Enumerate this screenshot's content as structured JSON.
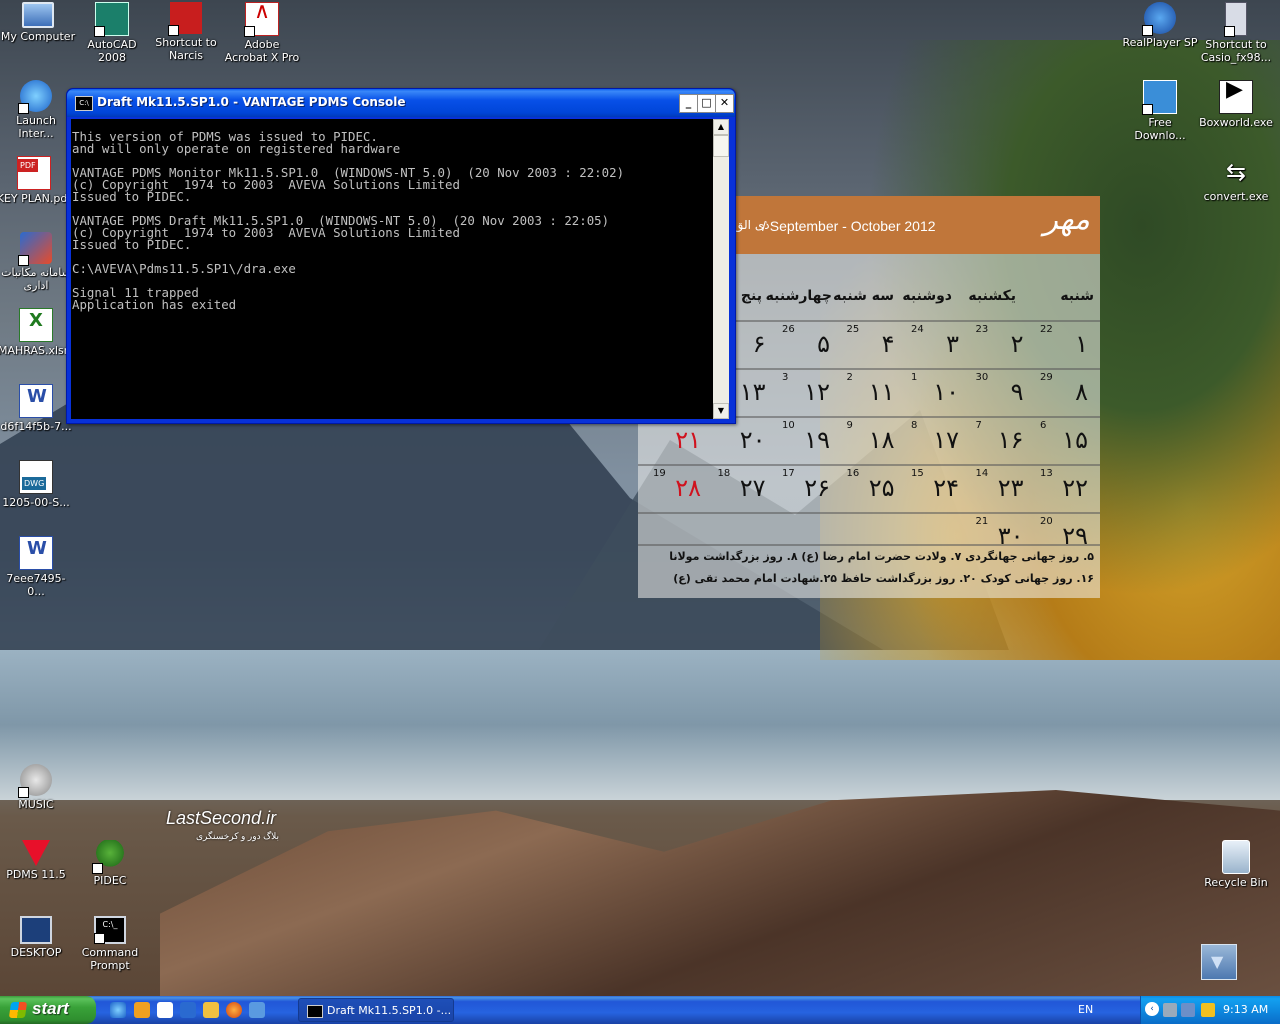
{
  "desktop": {
    "icons_left": [
      {
        "label": "My Computer",
        "icon": "my-computer-icon"
      },
      {
        "label": "AutoCAD 2008",
        "icon": "autocad-icon"
      },
      {
        "label": "Shortcut to Narcis",
        "icon": "narcis-icon"
      },
      {
        "label": "Adobe Acrobat X Pro",
        "icon": "acrobat-icon"
      },
      {
        "label": "Launch Inter...",
        "icon": "internet-explorer-icon"
      },
      {
        "label": "KEY PLAN.pdf",
        "icon": "pdf-file-icon"
      },
      {
        "label": "سامانه مكاتبات اداری",
        "icon": "correspondence-app-icon"
      },
      {
        "label": "MAHRAS.xlsm",
        "icon": "excel-file-icon"
      },
      {
        "label": "d6f14f5b-7...",
        "icon": "word-file-icon"
      },
      {
        "label": "1205-00-S...",
        "icon": "dwg-file-icon"
      },
      {
        "label": "7eee7495-0...",
        "icon": "word-file-icon"
      },
      {
        "label": "MUSIC",
        "icon": "music-folder-icon"
      },
      {
        "label": "PDMS 11.5",
        "icon": "pdms-icon"
      },
      {
        "label": "PIDEC",
        "icon": "pidec-icon"
      },
      {
        "label": "DESKTOP",
        "icon": "desktop-folder-icon"
      },
      {
        "label": "Command Prompt",
        "icon": "command-prompt-icon"
      }
    ],
    "icons_right": [
      {
        "label": "RealPlayer SP",
        "icon": "realplayer-icon"
      },
      {
        "label": "Shortcut to Casio_fx98...",
        "icon": "casio-icon"
      },
      {
        "label": "Free Downlo...",
        "icon": "free-download-icon"
      },
      {
        "label": "Boxworld.exe",
        "icon": "boxworld-icon"
      },
      {
        "label": "convert.exe",
        "icon": "convert-icon"
      },
      {
        "label": "Recycle Bin",
        "icon": "recycle-bin-icon"
      }
    ],
    "watermark": {
      "title": "LastSecond.ir",
      "subtitle": "بلاگ دور و كرخسنگری"
    }
  },
  "calendar": {
    "title_prefix": "ذی الق",
    "title": "/ September - October  2012",
    "month_name": "مهر",
    "weekdays": [
      "شنبه",
      "یکشنبه",
      "دوشنبه",
      "سه شنبه",
      "چهارشنبه",
      "پنج ش"
    ],
    "rows": [
      [
        {
          "n": "۱",
          "s": "22"
        },
        {
          "n": "۲",
          "s": "23"
        },
        {
          "n": "۳",
          "s": "24"
        },
        {
          "n": "۴",
          "s": "25"
        },
        {
          "n": "۵",
          "s": "26"
        },
        {
          "n": "۶",
          "s": ""
        }
      ],
      [
        {
          "n": "۸",
          "s": "29"
        },
        {
          "n": "۹",
          "s": "30"
        },
        {
          "n": "۱۰",
          "s": "1"
        },
        {
          "n": "۱۱",
          "s": "2"
        },
        {
          "n": "۱۲",
          "s": "3"
        },
        {
          "n": "۱۳",
          "s": ""
        }
      ],
      [
        {
          "n": "۱۵",
          "s": "6"
        },
        {
          "n": "۱۶",
          "s": "7"
        },
        {
          "n": "۱۷",
          "s": "8"
        },
        {
          "n": "۱۸",
          "s": "9"
        },
        {
          "n": "۱۹",
          "s": "10"
        },
        {
          "n": "۲۰",
          "s": ""
        },
        {
          "n": "۲۱",
          "s": "",
          "holiday": true
        }
      ],
      [
        {
          "n": "۲۲",
          "s": "13"
        },
        {
          "n": "۲۳",
          "s": "14"
        },
        {
          "n": "۲۴",
          "s": "15"
        },
        {
          "n": "۲۵",
          "s": "16"
        },
        {
          "n": "۲۶",
          "s": "17"
        },
        {
          "n": "۲۷",
          "s": "18"
        },
        {
          "n": "۲۸",
          "s": "19",
          "holiday": true
        }
      ],
      [
        {
          "n": "۲۹",
          "s": "20"
        },
        {
          "n": "۳۰",
          "s": "21"
        }
      ]
    ],
    "events": [
      "۵. روز جهانی جهانگردی   ۷. ولادت حضرت امام رضا (ع)   ۸. روز بزرگداشت مولانا",
      "۱۶. روز جهانی کودک   ۲۰. روز بزرگداشت حافظ   ۲۵.شهادت امام محمد تقی (ع)"
    ]
  },
  "window": {
    "title": "Draft Mk11.5.SP1.0 - VANTAGE PDMS Console",
    "console_lines": [
      "",
      "This version of PDMS was issued to PIDEC.",
      "and will only operate on registered hardware",
      "",
      "VANTAGE PDMS Monitor Mk11.5.SP1.0  (WINDOWS-NT 5.0)  (20 Nov 2003 : 22:02)",
      "(c) Copyright  1974 to 2003  AVEVA Solutions Limited",
      "Issued to PIDEC.",
      "",
      "VANTAGE PDMS Draft Mk11.5.SP1.0  (WINDOWS-NT 5.0)  (20 Nov 2003 : 22:05)",
      "(c) Copyright  1974 to 2003  AVEVA Solutions Limited",
      "Issued to PIDEC.",
      "",
      "C:\\AVEVA\\Pdms11.5.SP1\\/dra.exe",
      "",
      "Signal 11 trapped",
      "Application has exited"
    ]
  },
  "taskbar": {
    "start_label": "start",
    "task_button": "Draft Mk11.5.SP1.0 -...",
    "language": "EN",
    "clock": "9:13 AM"
  }
}
